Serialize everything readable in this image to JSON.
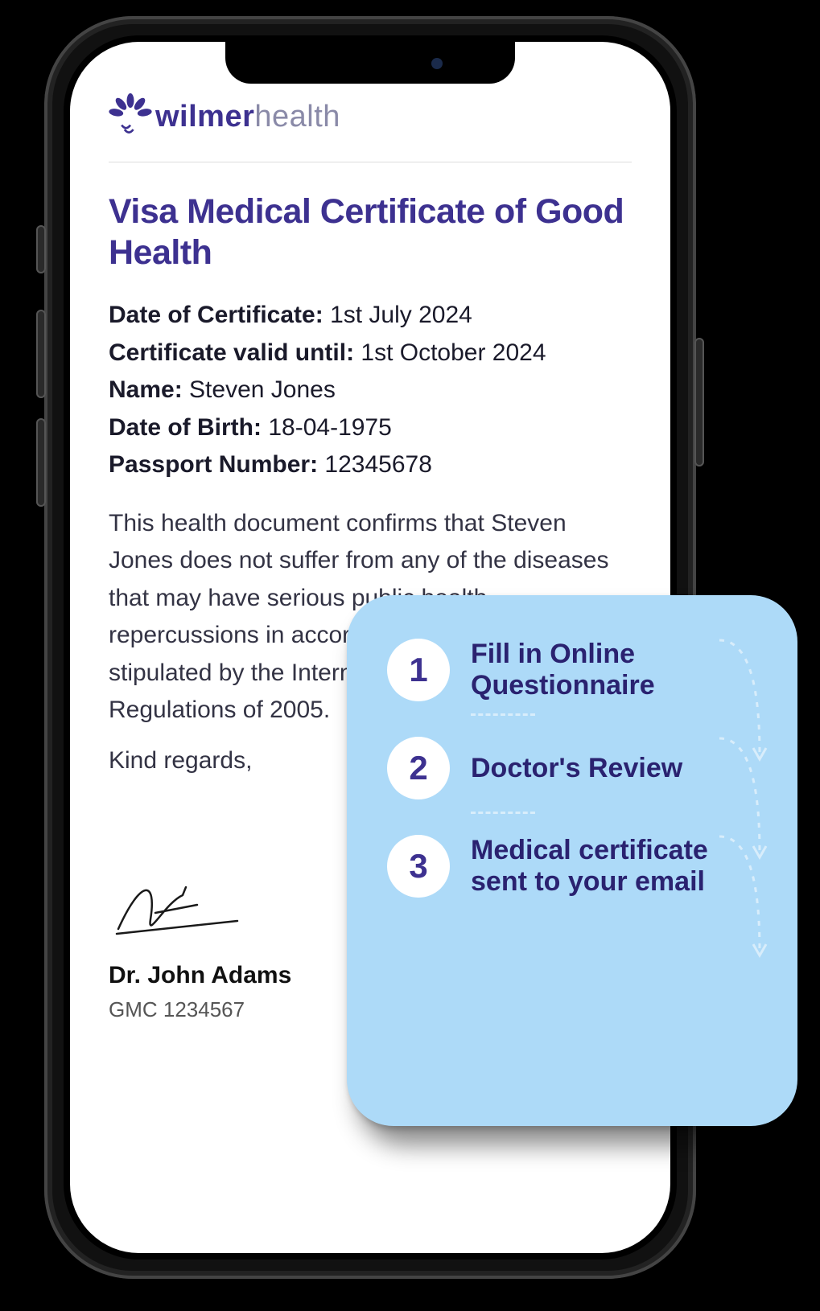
{
  "brand": {
    "word1": "wilmer",
    "word2": "health"
  },
  "certificate": {
    "title": "Visa Medical Certificate of Good Health",
    "fields": {
      "date_label": "Date of Certificate:",
      "date_value": "1st July 2024",
      "valid_label": "Certificate valid until:",
      "valid_value": "1st October 2024",
      "name_label": "Name:",
      "name_value": "Steven Jones",
      "dob_label": "Date of Birth:",
      "dob_value": "18-04-1975",
      "passport_label": "Passport Number:",
      "passport_value": "12345678"
    },
    "body": "This health document confirms that Steven Jones does not suffer from any of the diseases that may have serious public health repercussions in accordance with what is stipulated by the International Health Regulations of 2005.",
    "regards": "Kind regards,",
    "doctor_name": "Dr. John Adams",
    "gmc": "GMC 1234567"
  },
  "steps": [
    {
      "num": "1",
      "label": "Fill in Online Questionnaire"
    },
    {
      "num": "2",
      "label": "Doctor's Review"
    },
    {
      "num": "3",
      "label": "Medical certificate sent to your email"
    }
  ]
}
